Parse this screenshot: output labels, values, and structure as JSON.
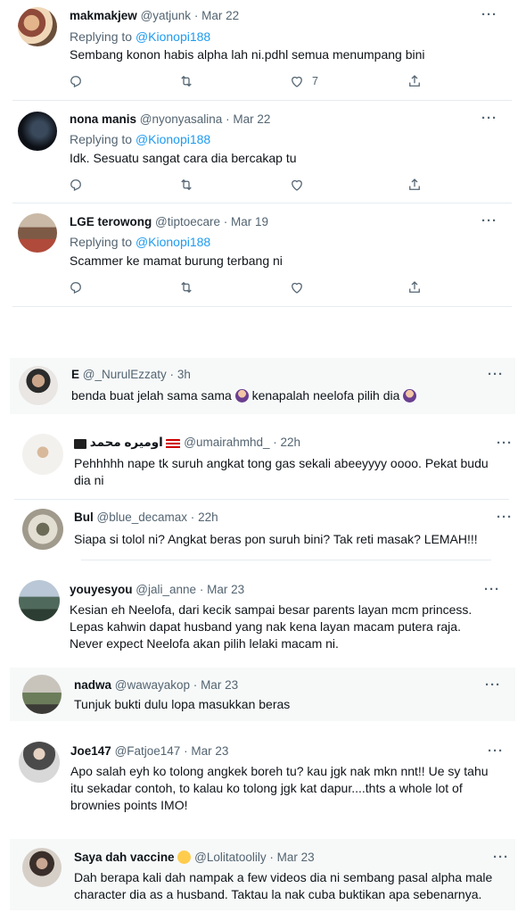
{
  "top_tweets": [
    {
      "name": "makmakjew",
      "handle": "@yatjunk",
      "date": "Mar 22",
      "replying_prefix": "Replying to",
      "replying_to": "@Kionopi188",
      "text": "Sembang konon habis alpha lah ni.pdhl semua menumpang bini",
      "like_count": "7"
    },
    {
      "name": "nona manis",
      "handle": "@nyonyasalina",
      "date": "Mar 22",
      "replying_prefix": "Replying to",
      "replying_to": "@Kionopi188",
      "text": "Idk. Sesuatu sangat cara dia bercakap tu",
      "like_count": ""
    },
    {
      "name": "LGE terowong",
      "handle": "@tiptoecare",
      "date": "Mar 19",
      "replying_prefix": "Replying to",
      "replying_to": "@Kionopi188",
      "text": "Scammer ke mamat burung terbang ni",
      "like_count": ""
    }
  ],
  "replies": [
    {
      "name": "E",
      "handle": "@_NurulEzzaty",
      "date": "3h",
      "text_a": "benda buat jelah sama sama",
      "text_b": "kenapalah neelofa pilih dia"
    },
    {
      "name": "اوميره محمد",
      "handle": "@umairahmhd_",
      "date": "22h",
      "text": "Pehhhhh nape tk suruh angkat tong gas sekali abeeyyyy oooo. Pekat budu dia ni"
    },
    {
      "name": "Bul",
      "handle": "@blue_decamax",
      "date": "22h",
      "text": "Siapa si tolol ni? Angkat beras pon suruh bini? Tak reti masak? LEMAH!!!"
    },
    {
      "name": "youyesyou",
      "handle": "@jali_anne",
      "date": "Mar 23",
      "text": "Kesian eh Neelofa, dari kecik sampai besar parents layan mcm princess. Lepas kahwin dapat husband yang nak kena layan macam putera raja. Never expect Neelofa akan pilih lelaki macam ni."
    },
    {
      "name": "nadwa",
      "handle": "@wawayakop",
      "date": "Mar 23",
      "text": "Tunjuk bukti dulu lopa masukkan beras"
    },
    {
      "name": "Joe147",
      "handle": "@Fatjoe147",
      "date": "Mar 23",
      "text": "Apo salah eyh ko tolong angkek boreh tu? kau jgk nak mkn nnt!! Ue sy tahu itu sekadar contoh, to kalau ko tolong jgk kat dapur....thts a whole lot of brownies points IMO!"
    },
    {
      "name": "Saya dah vaccine",
      "handle": "@Lolitatoolily",
      "date": "Mar 23",
      "text": "Dah berapa kali dah nampak a few videos dia ni sembang pasal alpha male character dia as a husband. Taktau la nak cuba buktikan apa sebenarnya."
    }
  ],
  "more_label": "···",
  "icons": [
    "reply-icon",
    "retweet-icon",
    "like-icon",
    "share-icon",
    "emoji-icon",
    "flag-icon"
  ],
  "colors": {
    "accent": "#1d9bf0",
    "text": "#0f1419",
    "muted": "#536471",
    "highlight_bg": "#f7f9f9"
  }
}
